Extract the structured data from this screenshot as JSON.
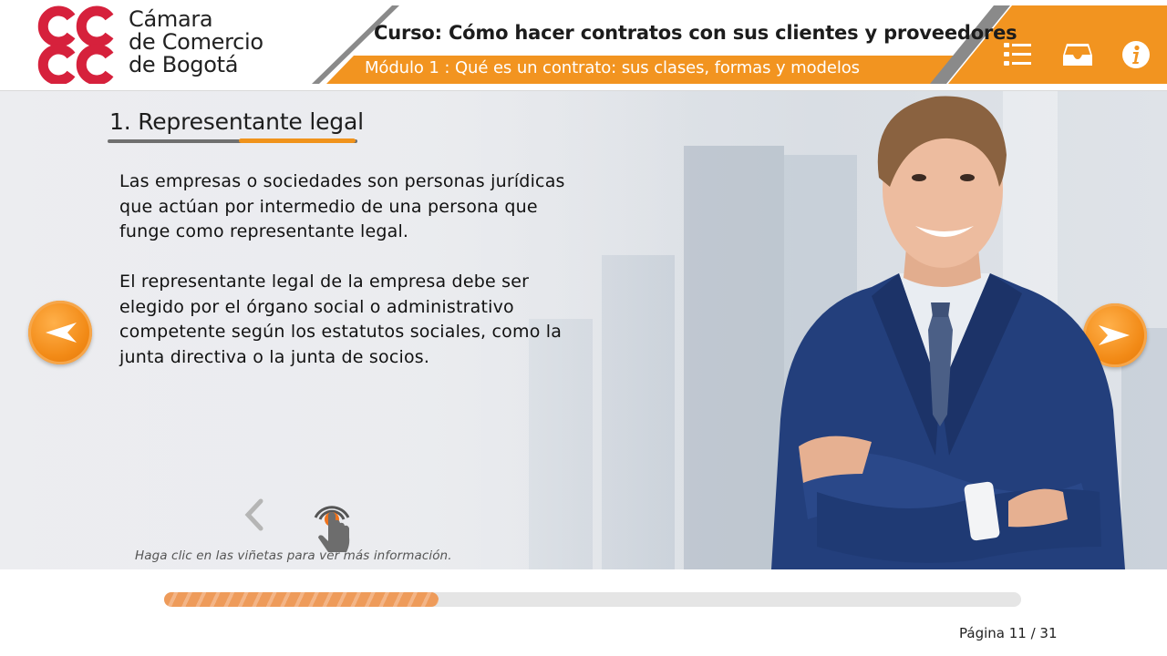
{
  "brand": {
    "line1": "Cámara",
    "line2": "de Comercio",
    "line3": "de Bogotá"
  },
  "header": {
    "course_title": "Curso: Cómo hacer contratos con sus clientes y proveedores",
    "module_title": "Módulo 1 : Qué es un contrato: sus clases, formas y modelos",
    "icons": [
      "menu-list-icon",
      "tray-icon",
      "info-icon"
    ]
  },
  "slide": {
    "section_title": "1. Representante legal",
    "paragraph1": "Las empresas o sociedades son personas jurídicas que actúan por intermedio de una persona que funge como representante legal.",
    "paragraph2": "El representante legal de la empresa debe ser elegido por el órgano social o administrativo competente según los estatutos sociales, como la junta directiva o la junta de socios.",
    "hint": "Haga clic en las viñetas para ver más información."
  },
  "progress": {
    "fraction": 0.32
  },
  "footer": {
    "page_label": "Página 11  / 31"
  },
  "colors": {
    "accent": "#f0931c",
    "brand_red": "#d6213c",
    "header_bg": "#ffffff"
  }
}
